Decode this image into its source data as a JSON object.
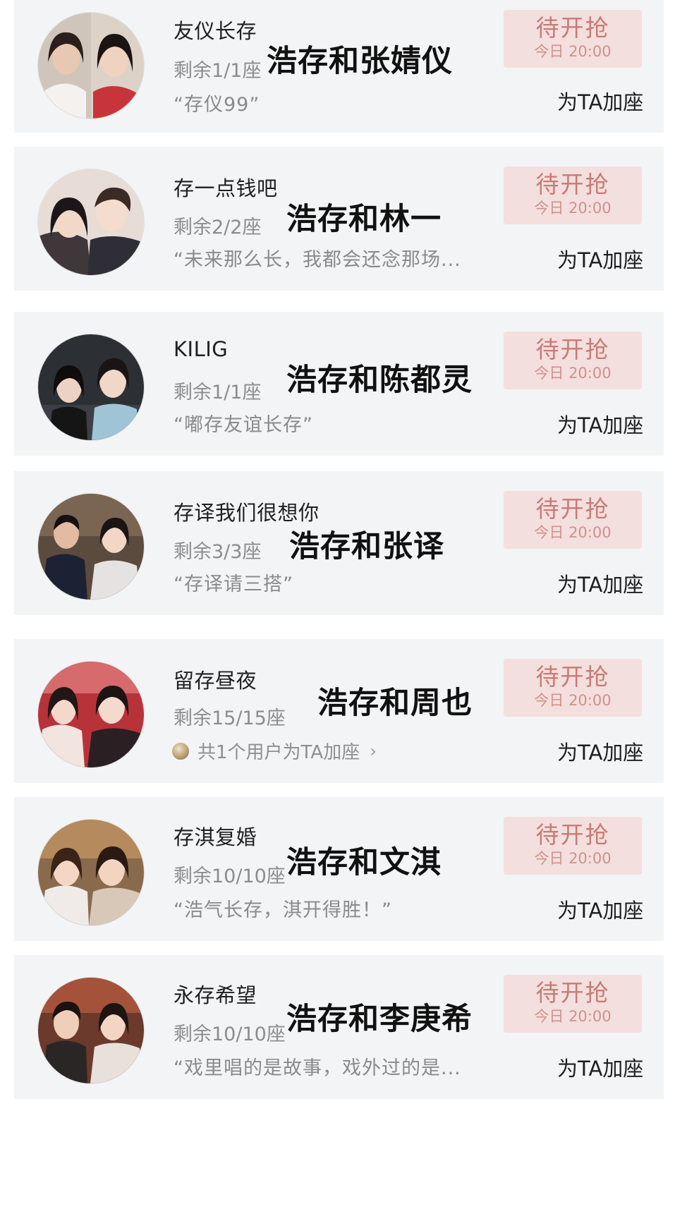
{
  "button_label": "待开抢",
  "button_time": "今日 20:00",
  "add_seat_label": "为TA加座",
  "cards": [
    {
      "name": "友仪长存",
      "seats": "剩余1/1座",
      "quote": "“存仪99”",
      "overlay": "浩存和张婧仪"
    },
    {
      "name": "存一点钱吧",
      "seats": "剩余2/2座",
      "quote": "“未来那么长，我都会还念那场...",
      "overlay": "浩存和林一"
    },
    {
      "name": "KILIG",
      "seats": "剩余1/1座",
      "quote": "“嘟存友谊长存”",
      "overlay": "浩存和陈都灵"
    },
    {
      "name": "存译我们很想你",
      "seats": "剩余3/3座",
      "quote": "“存译请三搭”",
      "overlay": "浩存和张译"
    },
    {
      "name": "留存昼夜",
      "seats": "剩余15/15座",
      "joiners": "共1个用户为TA加座",
      "overlay": "浩存和周也"
    },
    {
      "name": "存淇复婚",
      "seats": "剩余10/10座",
      "quote": "“浩气长存，淇开得胜！”",
      "overlay": "浩存和文淇"
    },
    {
      "name": "永存希望",
      "seats": "剩余10/10座",
      "quote": "“戏里唱的是故事，戏外过的是...",
      "overlay": "浩存和李庚希"
    }
  ]
}
